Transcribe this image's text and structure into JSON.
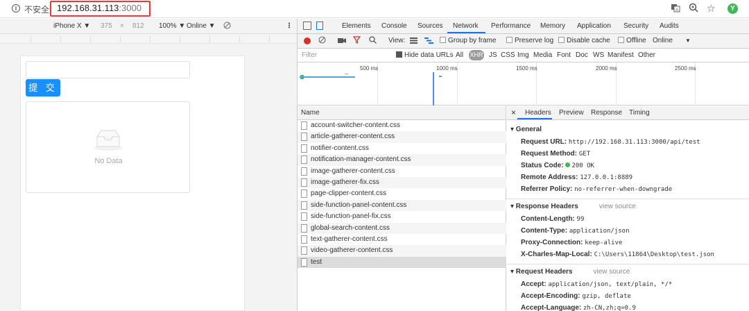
{
  "browser": {
    "info_icon": "info-icon",
    "insecure_label": "不安全",
    "url_host": "192.168.31.113",
    "url_port": ":3000",
    "right_icons": [
      "translate-icon",
      "zoom-icon",
      "star-icon",
      "extension-icon"
    ]
  },
  "device_toolbar": {
    "device": "iPhone X ▼",
    "width": "375",
    "times": "×",
    "height": "812",
    "zoom": "100% ▼",
    "network": "Online ▼",
    "rotate_icon": "rotate-icon",
    "menu": "⋮"
  },
  "page": {
    "input_value": "",
    "submit_label": "提 交",
    "empty_text": "No Data"
  },
  "devtools": {
    "tabs": [
      "Elements",
      "Console",
      "Sources",
      "Network",
      "Performance",
      "Memory",
      "Application",
      "Security",
      "Audits"
    ],
    "active_tab": "Network",
    "toolbar": {
      "view_label": "View:",
      "group_by_frame": "Group by frame",
      "preserve_log": "Preserve log",
      "disable_cache": "Disable cache",
      "offline": "Offline",
      "online": "Online",
      "dropdown": "▼"
    },
    "filter": {
      "placeholder": "Filter",
      "hide_data_urls": "Hide data URLs",
      "types": [
        "All",
        "XHR",
        "JS",
        "CSS",
        "Img",
        "Media",
        "Font",
        "Doc",
        "WS",
        "Manifest",
        "Other"
      ],
      "active_type": "XHR"
    },
    "timeline_labels": [
      "500 ms",
      "1000 ms",
      "1500 ms",
      "2000 ms",
      "2500 ms"
    ],
    "name_header": "Name",
    "requests": [
      "account-switcher-content.css",
      "article-gatherer-content.css",
      "notifier-content.css",
      "notification-manager-content.css",
      "image-gatherer-content.css",
      "image-gatherer-fix.css",
      "page-clipper-content.css",
      "side-function-panel-content.css",
      "side-function-panel-fix.css",
      "global-search-content.css",
      "text-gatherer-content.css",
      "video-gatherer-content.css",
      "test"
    ],
    "selected_request": "test",
    "detail_tabs": [
      "×",
      "Headers",
      "Preview",
      "Response",
      "Timing"
    ],
    "active_detail_tab": "Headers",
    "general": {
      "title": "▾ General",
      "rows": [
        {
          "k": "Request URL:",
          "v": "http://192.168.31.113:3000/api/test"
        },
        {
          "k": "Request Method:",
          "v": "GET"
        },
        {
          "k": "Status Code:",
          "v": "200 OK"
        },
        {
          "k": "Remote Address:",
          "v": "127.0.0.1:8889"
        },
        {
          "k": "Referrer Policy:",
          "v": "no-referrer-when-downgrade"
        }
      ]
    },
    "response_headers": {
      "title": "▾ Response Headers",
      "view_source": "view source",
      "rows": [
        {
          "k": "Content-Length:",
          "v": "99"
        },
        {
          "k": "Content-Type:",
          "v": "application/json"
        },
        {
          "k": "Proxy-Connection:",
          "v": "keep-alive"
        },
        {
          "k": "X-Charles-Map-Local:",
          "v": "C:\\Users\\11864\\Desktop\\test.json"
        }
      ]
    },
    "request_headers": {
      "title": "▾ Request Headers",
      "view_source": "view source",
      "rows": [
        {
          "k": "Accept:",
          "v": "application/json, text/plain, */*"
        },
        {
          "k": "Accept-Encoding:",
          "v": "gzip, deflate"
        },
        {
          "k": "Accept-Language:",
          "v": "zh-CN,zh;q=0.9"
        }
      ]
    }
  }
}
